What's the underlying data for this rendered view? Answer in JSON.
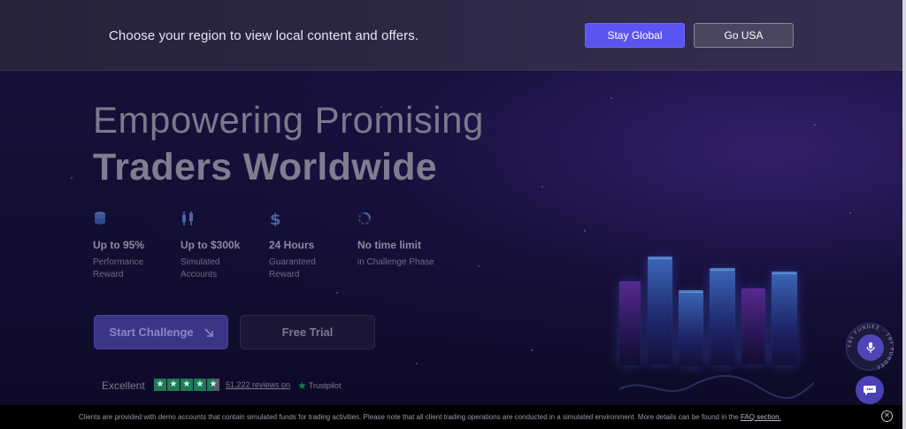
{
  "region_banner": {
    "message": "Choose your region to view local content and offers.",
    "stay_global_label": "Stay Global",
    "go_usa_label": "Go USA"
  },
  "hero": {
    "heading_line1": "Empowering Promising",
    "heading_line2": "Traders Worldwide"
  },
  "features": [
    {
      "icon": "coins-icon",
      "title": "Up to 95%",
      "desc_line1": "Performance",
      "desc_line2": "Reward"
    },
    {
      "icon": "candlestick-icon",
      "title": "Up to $300k",
      "desc_line1": "Simulated",
      "desc_line2": "Accounts"
    },
    {
      "icon": "dollar-icon",
      "title": "24 Hours",
      "desc_line1": "Guaranteed",
      "desc_line2": "Reward"
    },
    {
      "icon": "loader-icon",
      "title": "No time limit",
      "desc_line1": "in Challenge Phase",
      "desc_line2": ""
    }
  ],
  "cta": {
    "start_label": "Start Challenge",
    "start_icon": "arrow-down-right-icon",
    "free_label": "Free Trial"
  },
  "trustpilot": {
    "rating_text": "Excellent",
    "stars": 4.5,
    "reviews_text": "51,222 reviews on",
    "brand": "Trustpilot"
  },
  "voice_widget": {
    "ring_text": "TRY FUNDEE · TRY FUNDEE ·",
    "icon": "microphone-icon"
  },
  "chat_widget": {
    "icon": "chat-icon"
  },
  "footer": {
    "disclaimer": "Clients are provided with demo accounts that contain simulated funds for trading activities. Please note that all client trading operations are conducted in a simulated environment. More details can be found in the ",
    "link_text": "FAQ section.",
    "close_icon": "close-icon"
  },
  "colors": {
    "primary": "#5b54f0",
    "background": "#120e32",
    "trustpilot_green": "#1f7a55"
  }
}
